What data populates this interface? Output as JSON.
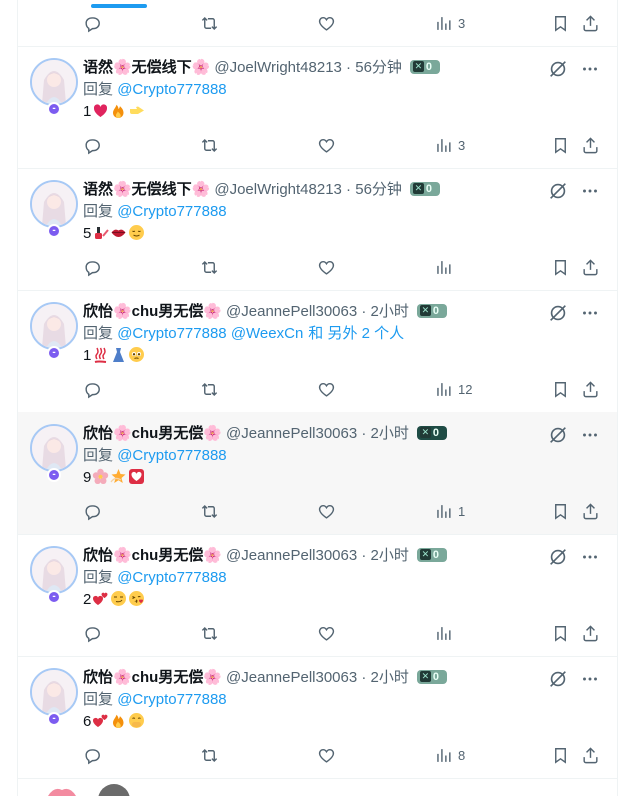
{
  "top": {
    "views_count": "3"
  },
  "tweets": [
    {
      "name": "语然🌸无偿线下🌸",
      "handle": "@JoelWright48213",
      "time": "56分钟",
      "badge_count": "0",
      "reply_label": "回复",
      "mention": "@Crypto777888",
      "mention_extra": "",
      "text": "1",
      "emojis": [
        "heart-red",
        "fire",
        "point-right"
      ],
      "views_count": "3"
    },
    {
      "name": "语然🌸无偿线下🌸",
      "handle": "@JoelWright48213",
      "time": "56分钟",
      "badge_count": "0",
      "reply_label": "回复",
      "mention": "@Crypto777888",
      "mention_extra": "",
      "text": "5",
      "emojis": [
        "nail-polish",
        "lips",
        "relieved"
      ],
      "views_count": ""
    },
    {
      "name": "欣怡🌸chu男无偿🌸",
      "handle": "@JeannePell30063",
      "time": "2小时",
      "badge_count": "0",
      "reply_label": "回复",
      "mention": "@Crypto777888 @WeexCn",
      "mention_extra": "和 另外 2 个人",
      "text": "1",
      "emojis": [
        "hot-springs",
        "dress",
        "pleading"
      ],
      "views_count": "12"
    },
    {
      "name": "欣怡🌸chu男无偿🌸",
      "handle": "@JeannePell30063",
      "time": "2小时",
      "badge_count": "0",
      "reply_label": "回复",
      "mention": "@Crypto777888",
      "mention_extra": "",
      "text": "9",
      "emojis": [
        "blossom",
        "dizzy",
        "heart-box"
      ],
      "views_count": "1"
    },
    {
      "name": "欣怡🌸chu男无偿🌸",
      "handle": "@JeannePell30063",
      "time": "2小时",
      "badge_count": "0",
      "reply_label": "回复",
      "mention": "@Crypto777888",
      "mention_extra": "",
      "text": "2",
      "emojis": [
        "two-hearts",
        "smirk",
        "kiss"
      ],
      "views_count": ""
    },
    {
      "name": "欣怡🌸chu男无偿🌸",
      "handle": "@JeannePell30063",
      "time": "2小时",
      "badge_count": "0",
      "reply_label": "回复",
      "mention": "@Crypto777888",
      "mention_extra": "",
      "text": "6",
      "emojis": [
        "two-hearts",
        "fire",
        "hand-over-mouth"
      ],
      "views_count": "8"
    }
  ],
  "colors": {
    "link": "#1d9bf0",
    "muted": "#536471",
    "border": "#eff3f4",
    "highlight_bg": "#f7f7f7"
  },
  "icons": {
    "reply": "reply-icon",
    "repost": "repost-icon",
    "like": "like-icon",
    "views": "views-icon",
    "bookmark": "bookmark-icon",
    "share": "share-icon",
    "grok": "grok-icon",
    "more": "more-icon"
  }
}
